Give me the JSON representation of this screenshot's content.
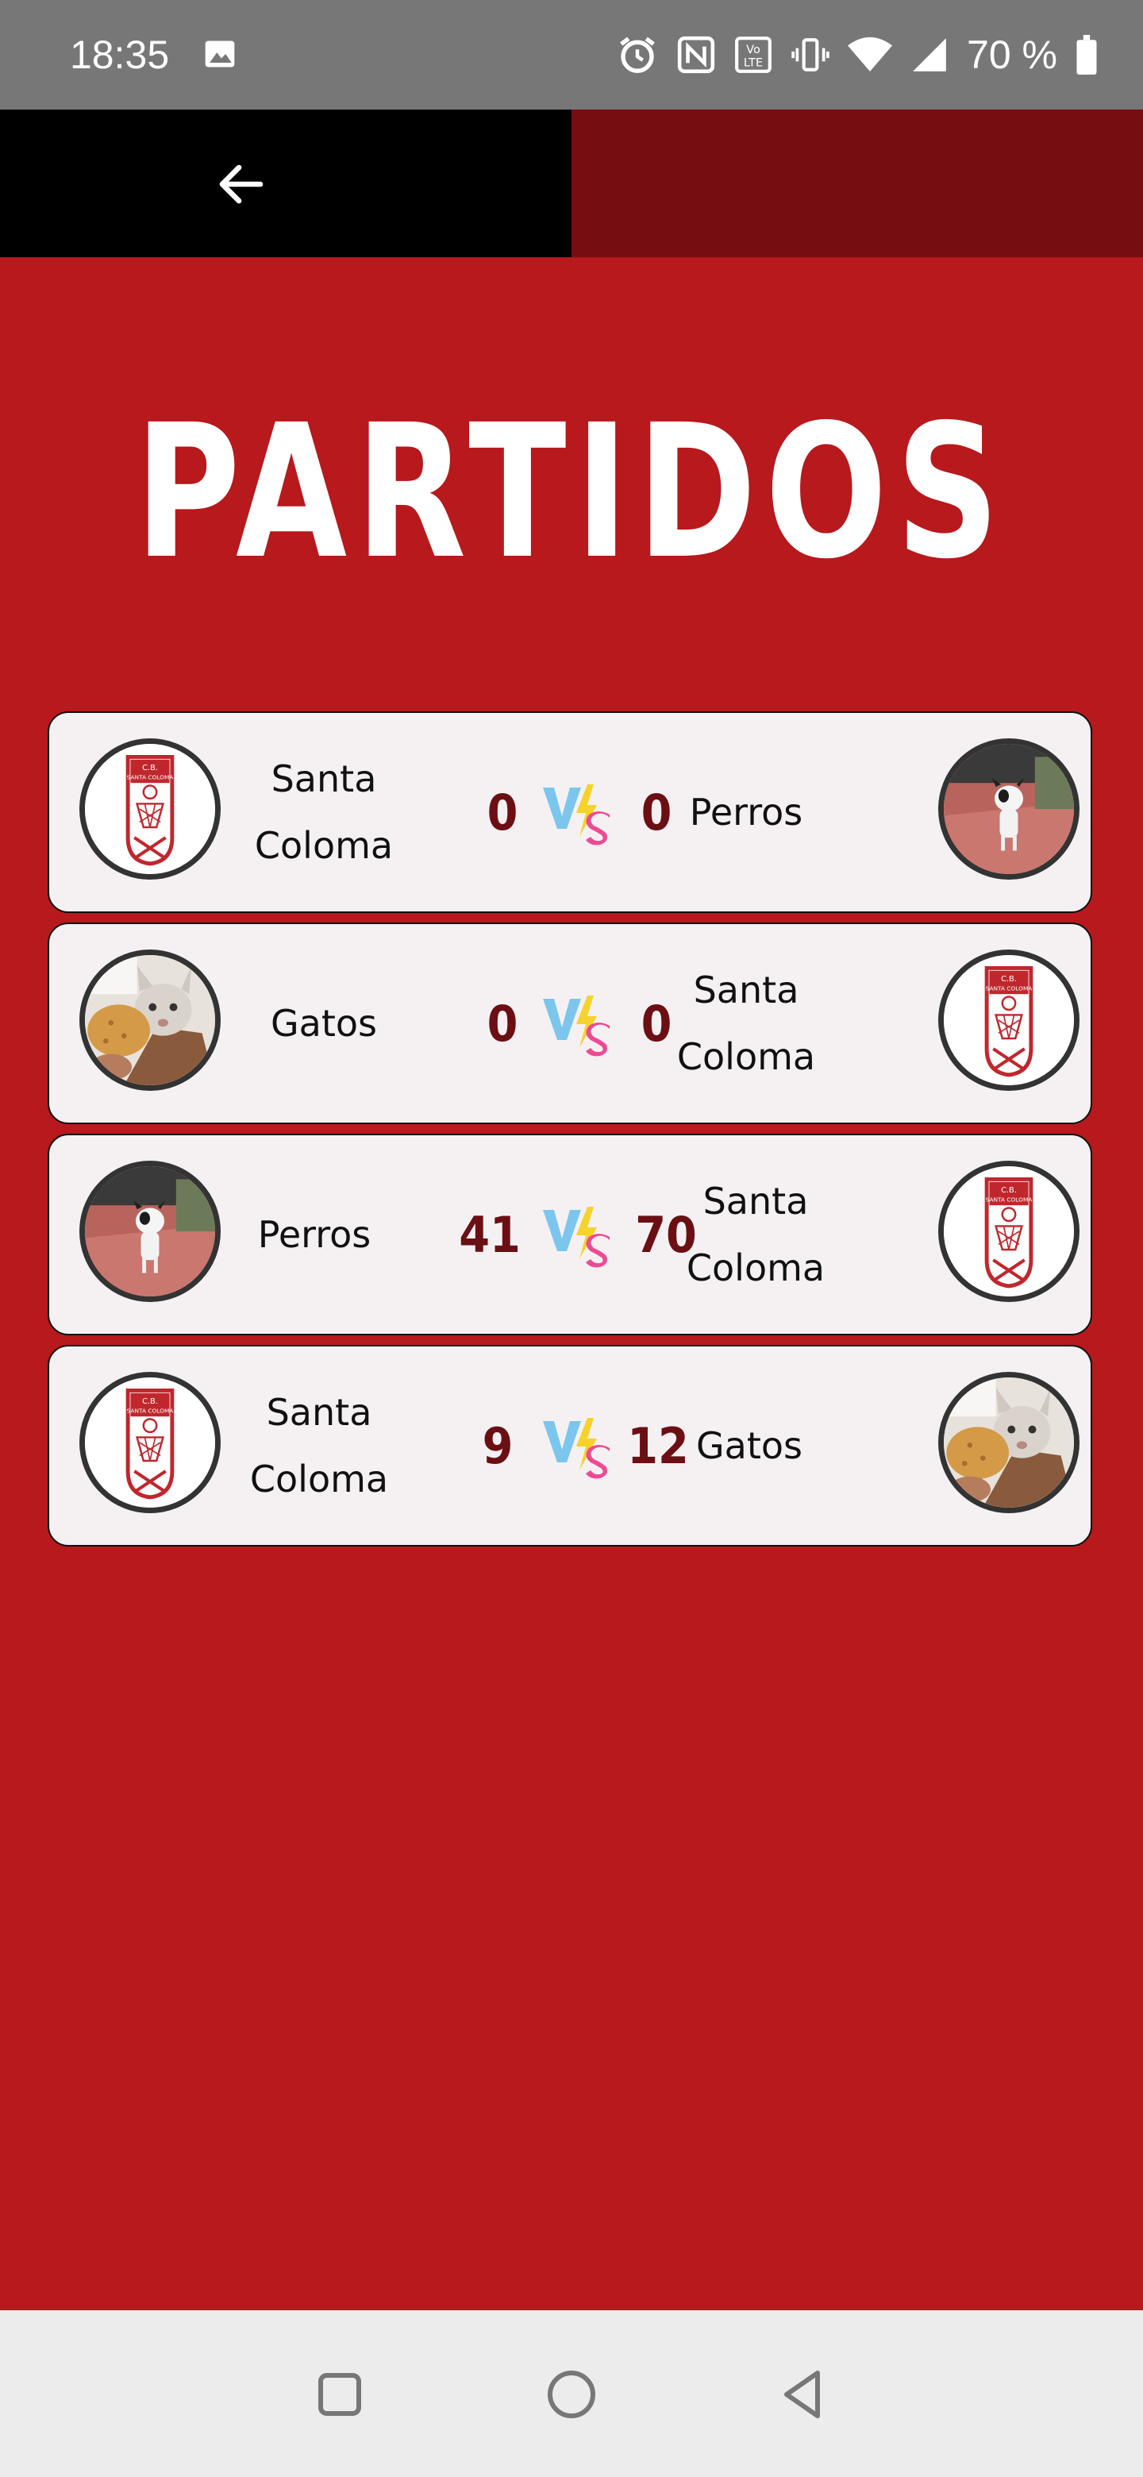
{
  "status_bar": {
    "time": "18:35",
    "battery": "70 %",
    "icons": [
      "image-icon",
      "alarm-icon",
      "nfc-icon",
      "volte-icon",
      "vibrate-icon",
      "wifi-icon",
      "signal-icon",
      "battery-icon"
    ]
  },
  "header": {
    "back_icon": "arrow-left-icon",
    "colors": {
      "left": "#000000",
      "right": "#760d10"
    }
  },
  "page": {
    "title": "PARTIDOS",
    "background": "#b7191c"
  },
  "matches": [
    {
      "home": "Santa Coloma",
      "home_score": "0",
      "away_score": "0",
      "away": "Perros",
      "home_logo": "club-crest",
      "away_logo": "dog-photo"
    },
    {
      "home": "Gatos",
      "home_score": "0",
      "away_score": "0",
      "away": "Santa Coloma",
      "home_logo": "cat-photo",
      "away_logo": "club-crest"
    },
    {
      "home": "Perros",
      "home_score": "41",
      "away_score": "70",
      "away": "Santa Coloma",
      "home_logo": "dog-photo",
      "away_logo": "club-crest"
    },
    {
      "home": "Santa Coloma",
      "home_score": "9",
      "away_score": "12",
      "away": "Gatos",
      "home_logo": "club-crest",
      "away_logo": "cat-photo"
    }
  ],
  "nav_bar": {
    "buttons": [
      "recent-apps-icon",
      "home-icon",
      "back-icon"
    ]
  }
}
